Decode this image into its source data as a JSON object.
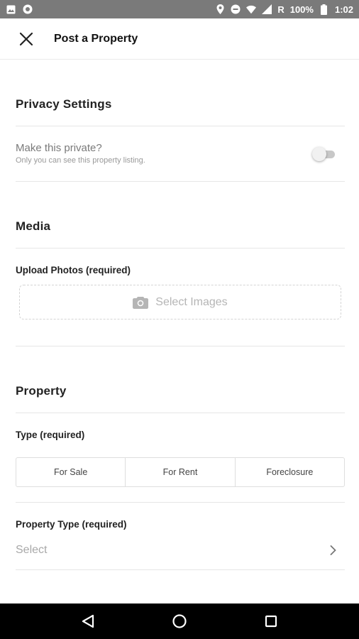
{
  "status_bar": {
    "signal_label": "R",
    "battery_percent": "100%",
    "time": "1:02",
    "left_icons": [
      "image-icon",
      "record-icon"
    ],
    "right_icons": [
      "location-icon",
      "dnd-icon",
      "wifi-icon",
      "cell-signal-icon",
      "battery-icon"
    ]
  },
  "app_bar": {
    "title": "Post a Property",
    "close_icon": "close-icon"
  },
  "privacy": {
    "section_title": "Privacy Settings",
    "toggle_label": "Make this private?",
    "toggle_description": "Only you can see this property listing.",
    "toggle_on": false
  },
  "media": {
    "section_title": "Media",
    "upload_label": "Upload Photos (required)",
    "select_images_label": "Select Images",
    "camera_icon": "camera-icon"
  },
  "property": {
    "section_title": "Property",
    "type_label": "Type (required)",
    "type_options": [
      "For Sale",
      "For Rent",
      "Foreclosure"
    ],
    "property_type_label": "Property Type (required)",
    "property_type_value": "Select"
  },
  "nav_bar": {
    "buttons": [
      "back-icon",
      "home-icon",
      "recents-icon"
    ]
  },
  "colors": {
    "status_bar": "#7a7a7a",
    "divider": "#e6e6e6",
    "nav_bar": "#000000"
  }
}
